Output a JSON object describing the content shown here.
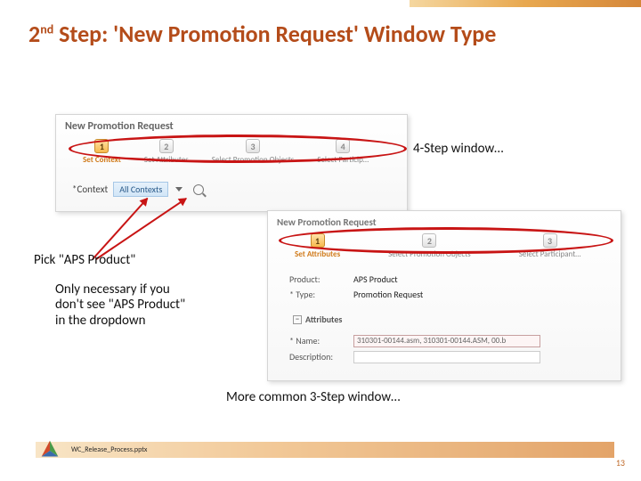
{
  "title": {
    "prefix_num": "2",
    "prefix_ord": "nd",
    "rest": " Step:  'New Promotion Request' Window Type"
  },
  "callouts": {
    "four_step": "4-Step window…",
    "pick_aps": "Pick \"APS Product\"",
    "only_necessary": "Only necessary if you don't see \"APS Product\" in the dropdown",
    "three_step": "More common 3-Step window…"
  },
  "shot1": {
    "window_title": "New Promotion Request",
    "steps": [
      {
        "num": "1",
        "label": "Set Context"
      },
      {
        "num": "2",
        "label": "Set Attributes"
      },
      {
        "num": "3",
        "label": "Select Promotion Objects"
      },
      {
        "num": "4",
        "label": "Select Particip…"
      }
    ],
    "context_label": "*Context",
    "context_value": "All Contexts"
  },
  "shot2": {
    "window_title": "New Promotion Request",
    "steps": [
      {
        "num": "1",
        "label": "Set Attributes"
      },
      {
        "num": "2",
        "label": "Select Promotion Objects"
      },
      {
        "num": "3",
        "label": "Select Participant…"
      }
    ],
    "product_label": "Product:",
    "product_value": "APS Product",
    "type_label": "* Type:",
    "type_value": "Promotion Request",
    "attributes_header": "Attributes",
    "name_label": "* Name:",
    "name_value": "310301-00144.asm, 310301-00144.ASM, 00.b",
    "desc_label": "Description:"
  },
  "footer": {
    "filename": "WC_Release_Process.pptx",
    "page": "13"
  }
}
